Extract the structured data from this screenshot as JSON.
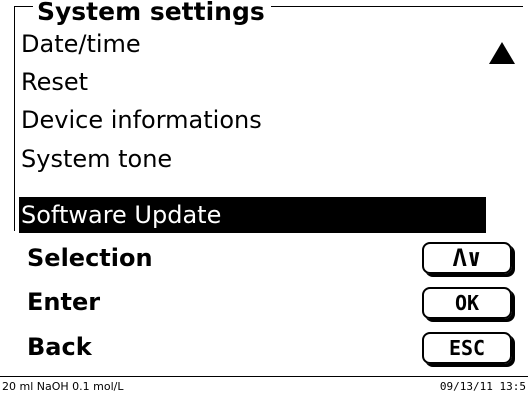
{
  "panel": {
    "title": "System settings",
    "items": [
      {
        "label": "Date/time"
      },
      {
        "label": "Reset"
      },
      {
        "label": "Device informations"
      },
      {
        "label": "System tone"
      },
      {
        "label": "Software Update"
      }
    ],
    "selected_index": 4,
    "scroll_indicator_icon": "triangle-up-icon"
  },
  "softkeys": {
    "selection": {
      "label": "Selection",
      "key_text": "Λ∨",
      "icon": "up-down-arrows-icon"
    },
    "enter": {
      "label": "Enter",
      "key_text": "OK"
    },
    "back": {
      "label": "Back",
      "key_text": "ESC"
    }
  },
  "status_bar": {
    "left": "20 ml NaOH 0.1 mol/L",
    "right": "09/13/11 13:5"
  }
}
